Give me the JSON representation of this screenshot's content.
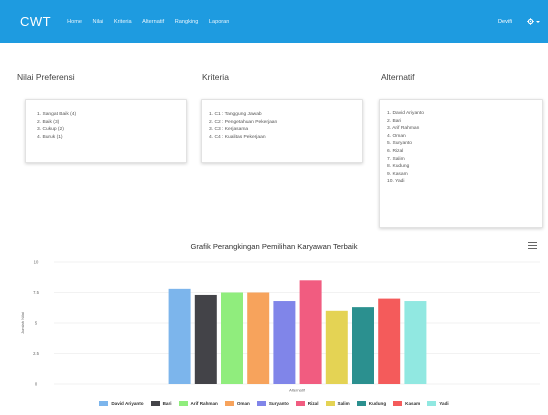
{
  "navbar": {
    "brand": "CWT",
    "items": [
      "Home",
      "Nilai",
      "Kriteria",
      "Alternatif",
      "Rangking",
      "Laporan"
    ],
    "user": "Devifi",
    "bg_color": "#1e9be0"
  },
  "preferensi": {
    "title": "Nilai Preferensi",
    "items": [
      "1. Sangat Baik (4)",
      "2. Baik (3)",
      "3. Cukup (2)",
      "4. Buruk (1)"
    ]
  },
  "kriteria": {
    "title": "Kriteria",
    "items": [
      "1. C1 : Tanggung Jawab",
      "2. C2 : Pengetahuan Pekerjaan",
      "3. C3 : Kerjasama",
      "4. C4 : Kualitas Pekerjaan"
    ]
  },
  "alternatif": {
    "title": "Alternatif",
    "items": [
      "1. David Ariyanto",
      "2. Bari",
      "3. Arif Rahman",
      "4. Oman",
      "5. Suryanto",
      "6. Rizal",
      "7. Salim",
      "8. Kudung",
      "9. Kasam",
      "10. Yadi"
    ]
  },
  "chart_data": {
    "type": "bar",
    "title": "Grafik Perangkingan Pemilihan Karyawan Terbaik",
    "xlabel": "Alternatif",
    "ylabel": "Jumlah Nilai",
    "ylim": [
      0,
      10
    ],
    "yticks": [
      "0",
      "2.5",
      "5",
      "7.5",
      "10"
    ],
    "grid": true,
    "legend_position": "bottom",
    "categories": [
      "Alternatif"
    ],
    "series": [
      {
        "name": "David Ariyanto",
        "values": [
          7.8
        ],
        "color": "#7cb5ec"
      },
      {
        "name": "Bari",
        "values": [
          7.3
        ],
        "color": "#434348"
      },
      {
        "name": "Arif Rahman",
        "values": [
          7.5
        ],
        "color": "#90ed7d"
      },
      {
        "name": "Oman",
        "values": [
          7.5
        ],
        "color": "#f7a35c"
      },
      {
        "name": "Suryanto",
        "values": [
          6.8
        ],
        "color": "#8085e9"
      },
      {
        "name": "Rizal",
        "values": [
          8.5
        ],
        "color": "#f15c80"
      },
      {
        "name": "Salim",
        "values": [
          6.0
        ],
        "color": "#e4d354"
      },
      {
        "name": "Kudung",
        "values": [
          6.3
        ],
        "color": "#2b908f"
      },
      {
        "name": "Kasam",
        "values": [
          7.0
        ],
        "color": "#f45b5b"
      },
      {
        "name": "Yadi",
        "values": [
          6.8
        ],
        "color": "#91e8e1"
      }
    ]
  }
}
